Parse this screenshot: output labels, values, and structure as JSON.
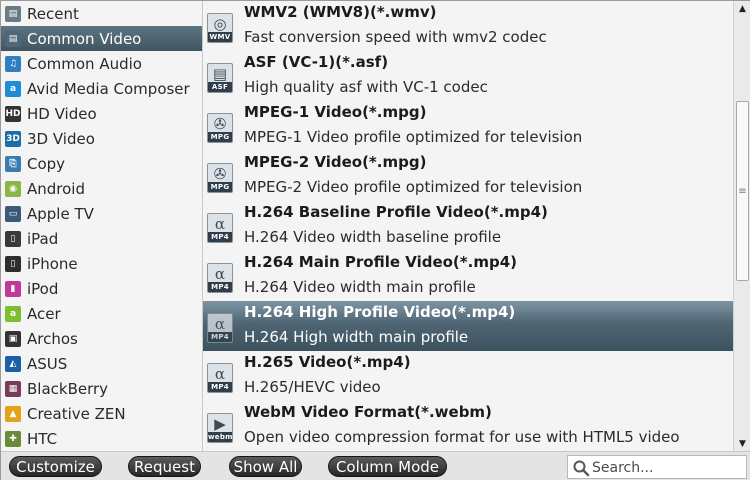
{
  "categories": [
    {
      "label": "Recent",
      "icon": "film-icon",
      "color": "#6b7b86",
      "glyph": "▤"
    },
    {
      "label": "Common Video",
      "icon": "film-icon",
      "color": "#4e6675",
      "glyph": "▤",
      "selected": true
    },
    {
      "label": "Common Audio",
      "icon": "music-note-icon",
      "color": "#2f7fc1",
      "glyph": "♫"
    },
    {
      "label": "Avid Media Composer",
      "icon": "avid-icon",
      "color": "#1f8dd6",
      "glyph": "a"
    },
    {
      "label": "HD Video",
      "icon": "hd-icon",
      "color": "#333333",
      "glyph": "HD"
    },
    {
      "label": "3D Video",
      "icon": "3d-icon",
      "color": "#1b6fa8",
      "glyph": "3D"
    },
    {
      "label": "Copy",
      "icon": "copy-icon",
      "color": "#3a7bb0",
      "glyph": "⎘"
    },
    {
      "label": "Android",
      "icon": "android-icon",
      "color": "#8ab644",
      "glyph": "◉"
    },
    {
      "label": "Apple TV",
      "icon": "apple-tv-icon",
      "color": "#3a5a78",
      "glyph": "▭"
    },
    {
      "label": "iPad",
      "icon": "ipad-icon",
      "color": "#3a3a3a",
      "glyph": "▯"
    },
    {
      "label": "iPhone",
      "icon": "iphone-icon",
      "color": "#2e2e2e",
      "glyph": "▯"
    },
    {
      "label": "iPod",
      "icon": "ipod-icon",
      "color": "#c0399a",
      "glyph": "▮"
    },
    {
      "label": "Acer",
      "icon": "acer-icon",
      "color": "#7dbf2c",
      "glyph": "a"
    },
    {
      "label": "Archos",
      "icon": "archos-icon",
      "color": "#333333",
      "glyph": "▣"
    },
    {
      "label": "ASUS",
      "icon": "asus-icon",
      "color": "#1b5fa6",
      "glyph": "◭"
    },
    {
      "label": "BlackBerry",
      "icon": "blackberry-icon",
      "color": "#7a3b5b",
      "glyph": "▦"
    },
    {
      "label": "Creative ZEN",
      "icon": "creative-zen-icon",
      "color": "#e3a21a",
      "glyph": "▲"
    },
    {
      "label": "HTC",
      "icon": "htc-icon",
      "color": "#6a8a3a",
      "glyph": "✚"
    }
  ],
  "formats": [
    {
      "title": "WMV2 (WMV8)(*.wmv)",
      "desc": "Fast conversion speed with wmv2 codec",
      "icon": "wmv-icon",
      "glyph": "◎",
      "tag": "WMV"
    },
    {
      "title": "ASF (VC-1)(*.asf)",
      "desc": "High quality asf with VC-1 codec",
      "icon": "asf-icon",
      "glyph": "▤",
      "tag": "ASF"
    },
    {
      "title": "MPEG-1 Video(*.mpg)",
      "desc": "MPEG-1 Video profile optimized for television",
      "icon": "mpg-icon",
      "glyph": "✇",
      "tag": "MPG"
    },
    {
      "title": "MPEG-2 Video(*.mpg)",
      "desc": "MPEG-2 Video profile optimized for television",
      "icon": "mpg-icon",
      "glyph": "✇",
      "tag": "MPG"
    },
    {
      "title": "H.264 Baseline Profile Video(*.mp4)",
      "desc": "H.264 Video width baseline profile",
      "icon": "mp4-icon",
      "glyph": "α",
      "tag": "MP4"
    },
    {
      "title": "H.264 Main Profile Video(*.mp4)",
      "desc": "H.264 Video width main profile",
      "icon": "mp4-icon",
      "glyph": "α",
      "tag": "MP4"
    },
    {
      "title": "H.264 High Profile Video(*.mp4)",
      "desc": "H.264 High width main profile",
      "icon": "mp4-icon",
      "glyph": "α",
      "tag": "MP4",
      "selected": true
    },
    {
      "title": "H.265 Video(*.mp4)",
      "desc": "H.265/HEVC video",
      "icon": "mp4-icon",
      "glyph": "α",
      "tag": "MP4"
    },
    {
      "title": "WebM Video Format(*.webm)",
      "desc": "Open video compression format for use with HTML5 video",
      "icon": "webm-icon",
      "glyph": "▶",
      "tag": "webm"
    }
  ],
  "toolbar": {
    "customize_label": "Customize",
    "request_label": "Request",
    "show_all_label": "Show All",
    "column_mode_label": "Column Mode",
    "search_placeholder": "Search..."
  },
  "scrollbar": {
    "up_glyph": "▲",
    "down_glyph": "▼",
    "thumb_glyph": "≡"
  }
}
